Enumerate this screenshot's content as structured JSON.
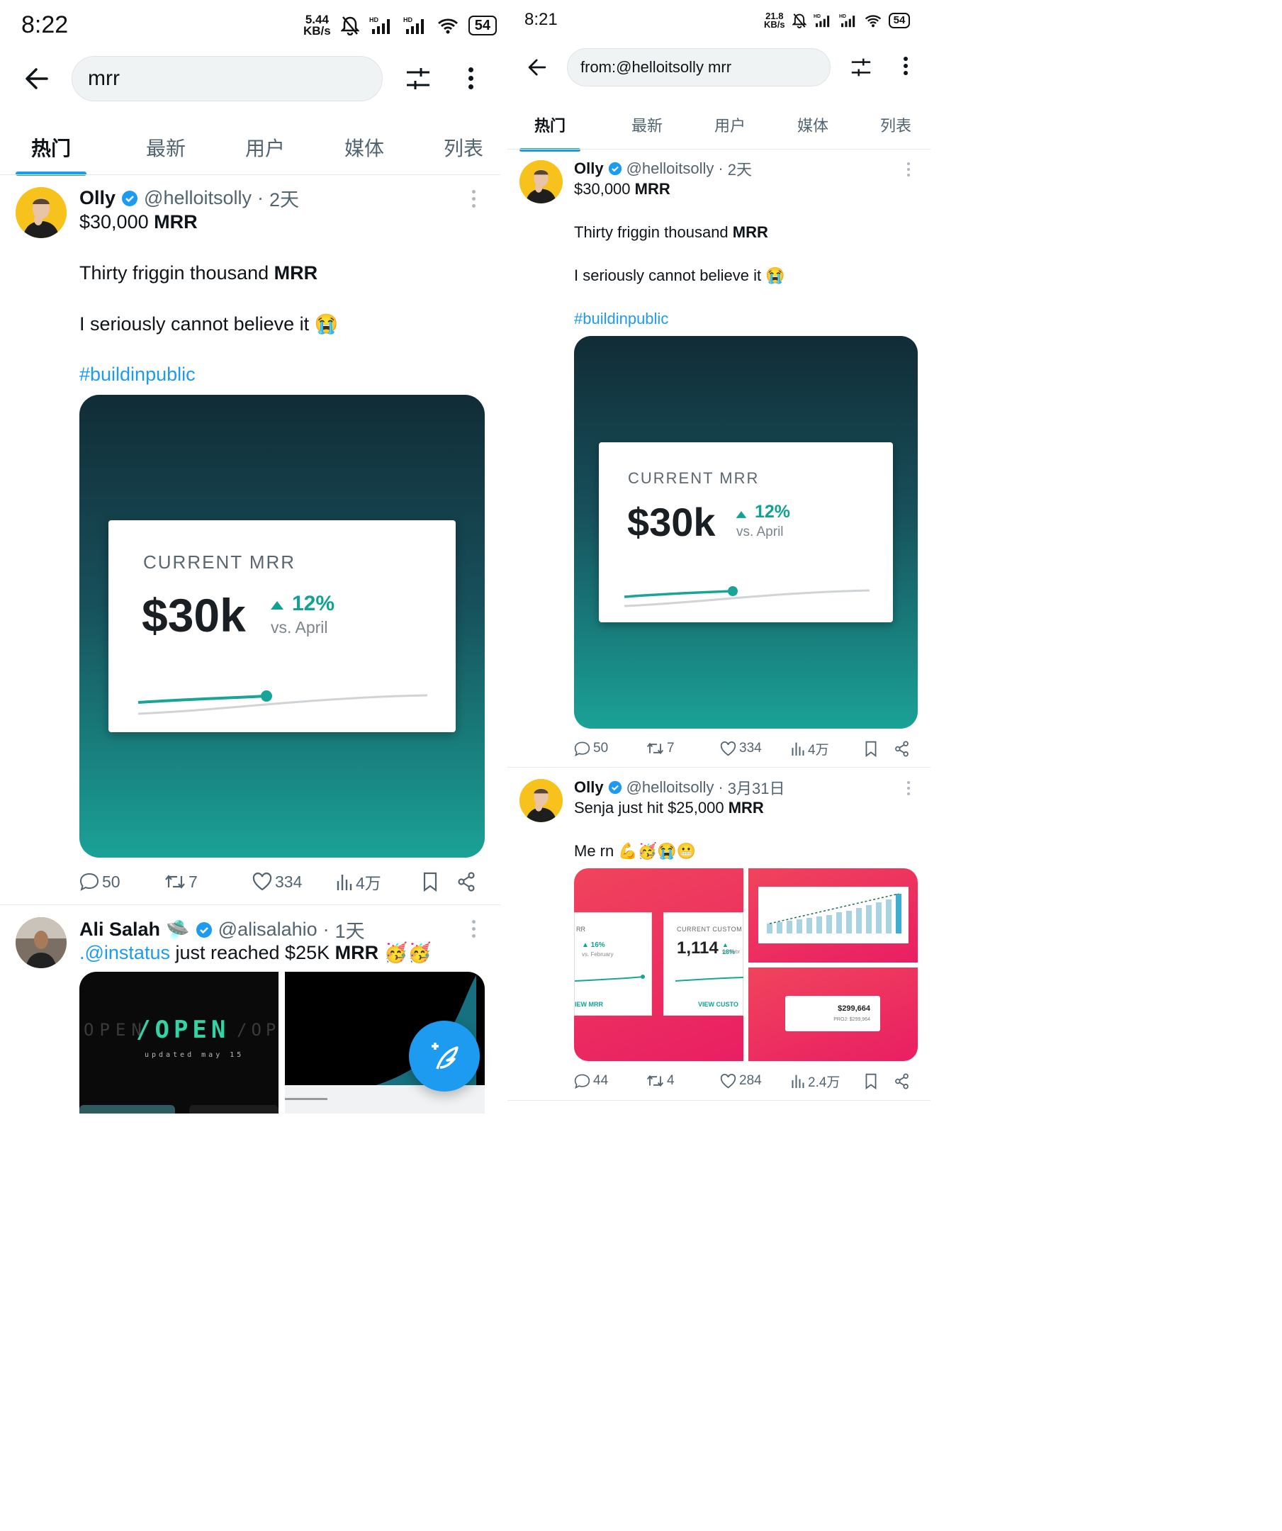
{
  "left": {
    "status": {
      "time": "8:22",
      "speed": "5.44\nKB/s",
      "battery": "54"
    },
    "search": {
      "value": "mrr"
    },
    "tabs": [
      "热门",
      "最新",
      "用户",
      "媒体",
      "列表"
    ],
    "tweet1": {
      "name": "Olly",
      "handle": "@helloitsolly",
      "time": "2天",
      "line1_a": "$30,000 ",
      "line1_b": "MRR",
      "line2_a": "Thirty friggin thousand ",
      "line2_b": "MRR",
      "line3": "I seriously cannot believe it 😭",
      "hashtag": "#buildinpublic",
      "card": {
        "label": "CURRENT MRR",
        "value": "$30k",
        "pct": "12%",
        "sub": "vs. April"
      },
      "stats": {
        "replies": "50",
        "retweets": "7",
        "likes": "334",
        "views": "4万"
      }
    },
    "tweet2": {
      "name": "Ali Salah",
      "badge_emoji": "🛸",
      "handle": "@alisalahio",
      "time": "1天",
      "mention": ".@instatus",
      "text_a": " just reached $25K ",
      "text_b": "MRR",
      "emoji": " 🥳🥳",
      "img1_main": "/OPEN",
      "img1_left": "OPEN",
      "img1_right": "/OPE",
      "img1_sub": "updated may 15"
    }
  },
  "right": {
    "status": {
      "time": "8:21",
      "speed": "21.8\nKB/s",
      "battery": "54"
    },
    "search": {
      "value": "from:@helloitsolly mrr"
    },
    "tabs": [
      "热门",
      "最新",
      "用户",
      "媒体",
      "列表"
    ],
    "tweet1": {
      "name": "Olly",
      "handle": "@helloitsolly",
      "time": "2天",
      "line1_a": "$30,000 ",
      "line1_b": "MRR",
      "line2_a": "Thirty friggin thousand ",
      "line2_b": "MRR",
      "line3": "I seriously cannot believe it 😭",
      "hashtag": "#buildinpublic",
      "card": {
        "label": "CURRENT MRR",
        "value": "$30k",
        "pct": "12%",
        "sub": "vs. April"
      },
      "stats": {
        "replies": "50",
        "retweets": "7",
        "likes": "334",
        "views": "4万"
      }
    },
    "tweet2": {
      "name": "Olly",
      "handle": "@helloitsolly",
      "time": "3月31日",
      "line1_a": "Senja just hit $25,000 ",
      "line1_b": "MRR",
      "line2": "Me rn 💪🥳😭😬",
      "img_a": {
        "l1": "RR",
        "l2": "▲ 16%",
        "l3": "vs. February",
        "l4": "IEW MRR"
      },
      "img_b": {
        "l1": "CURRENT CUSTOM",
        "l2": "1,114",
        "l3": "▲ 18%",
        "l4": "vs. Febr",
        "l5": "VIEW CUSTO"
      },
      "img_d": {
        "l1": "$299,664",
        "l2": "PROJ: $299,964"
      },
      "stats": {
        "replies": "44",
        "retweets": "4",
        "likes": "284",
        "views": "2.4万"
      }
    }
  }
}
